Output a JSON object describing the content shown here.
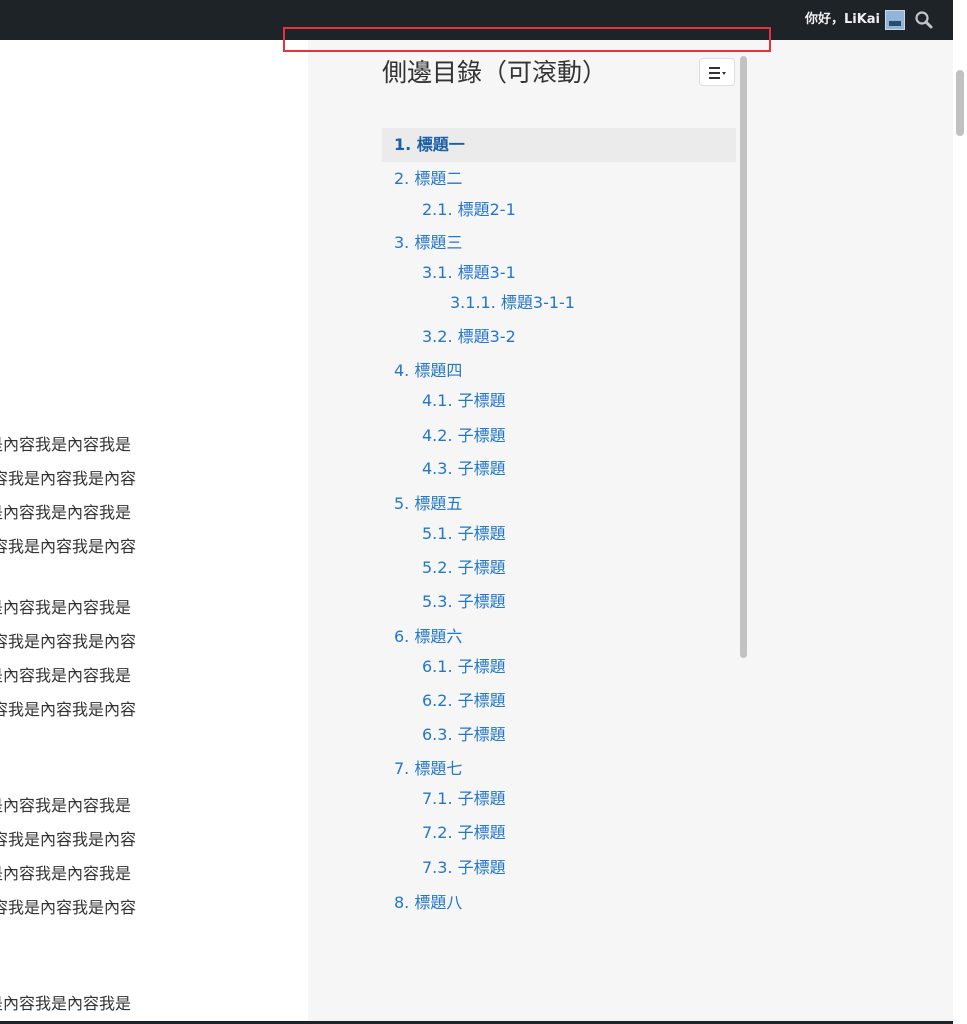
{
  "admin_bar": {
    "greeting": "你好，LiKai",
    "avatar_icon": "user-avatar-icon",
    "search_icon": "search-icon"
  },
  "content": {
    "paragraphs": [
      {
        "lines": [
          "是內容我是內容我是",
          "容我是內容我是內容",
          "是內容我是內容我是",
          "容我是內容我是內容"
        ]
      },
      {
        "lines": [
          "是內容我是內容我是",
          "容我是內容我是內容",
          "是內容我是內容我是",
          "容我是內容我是內容"
        ]
      },
      {
        "lines": [
          "是內容我是內容我是",
          "容我是內容我是內容",
          "是內容我是內容我是",
          "容我是內容我是內容"
        ]
      },
      {
        "lines": [
          "是內容我是內容我是"
        ]
      }
    ]
  },
  "toc": {
    "title": "側邊目錄（可滾動）",
    "toggle_icon": "list-toggle-icon",
    "items": [
      {
        "label": "1. 標題一",
        "level": 1,
        "active": true
      },
      {
        "label": "2. 標題二",
        "level": 1
      },
      {
        "label": "2.1. 標題2-1",
        "level": 2
      },
      {
        "label": "3. 標題三",
        "level": 1
      },
      {
        "label": "3.1. 標題3-1",
        "level": 2
      },
      {
        "label": "3.1.1. 標題3-1-1",
        "level": 3
      },
      {
        "label": "3.2. 標題3-2",
        "level": 2
      },
      {
        "label": "4. 標題四",
        "level": 1
      },
      {
        "label": "4.1. 子標題",
        "level": 2
      },
      {
        "label": "4.2. 子標題",
        "level": 2
      },
      {
        "label": "4.3. 子標題",
        "level": 2
      },
      {
        "label": "5. 標題五",
        "level": 1
      },
      {
        "label": "5.1. 子標題",
        "level": 2
      },
      {
        "label": "5.2. 子標題",
        "level": 2
      },
      {
        "label": "5.3. 子標題",
        "level": 2
      },
      {
        "label": "6. 標題六",
        "level": 1
      },
      {
        "label": "6.1. 子標題",
        "level": 2
      },
      {
        "label": "6.2. 子標題",
        "level": 2
      },
      {
        "label": "6.3. 子標題",
        "level": 2
      },
      {
        "label": "7. 標題七",
        "level": 1
      },
      {
        "label": "7.1. 子標題",
        "level": 2
      },
      {
        "label": "7.2. 子標題",
        "level": 2
      },
      {
        "label": "7.3. 子標題",
        "level": 2
      },
      {
        "label": "8. 標題八",
        "level": 1
      }
    ]
  },
  "colors": {
    "admin_bar_bg": "#1d2327",
    "link": "#2277c9",
    "active_link": "#1a5fa8",
    "highlight": "#e5333e"
  }
}
